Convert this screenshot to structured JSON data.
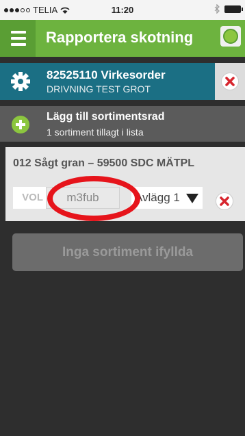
{
  "status_bar": {
    "carrier": "TELIA",
    "time": "11:20",
    "signal_dots_filled": 3,
    "signal_dots_total": 5
  },
  "header": {
    "title": "Rapportera skotning",
    "menu_icon": "hamburger-icon",
    "status_color": "#8cc63f"
  },
  "order": {
    "title": "82525110 Virkesorder",
    "subtitle": "DRIVNING TEST GROT",
    "icon": "gear-icon"
  },
  "add_row": {
    "title": "Lägg till sortimentsrad",
    "subtitle": "1 sortiment tillagt i lista",
    "icon": "plus-icon"
  },
  "item": {
    "title": "012 Sågt gran – 59500 SDC MÄTPL",
    "vol_label": "VOL",
    "unit_value": "m3fub",
    "pile_value": "Avlägg 1"
  },
  "empty_button": {
    "label": "Inga sortiment ifyllda"
  },
  "colors": {
    "header_green": "#6db33f",
    "order_teal": "#1b6f84",
    "remove_red": "#d7262e",
    "highlight_ring": "#e6141b"
  }
}
